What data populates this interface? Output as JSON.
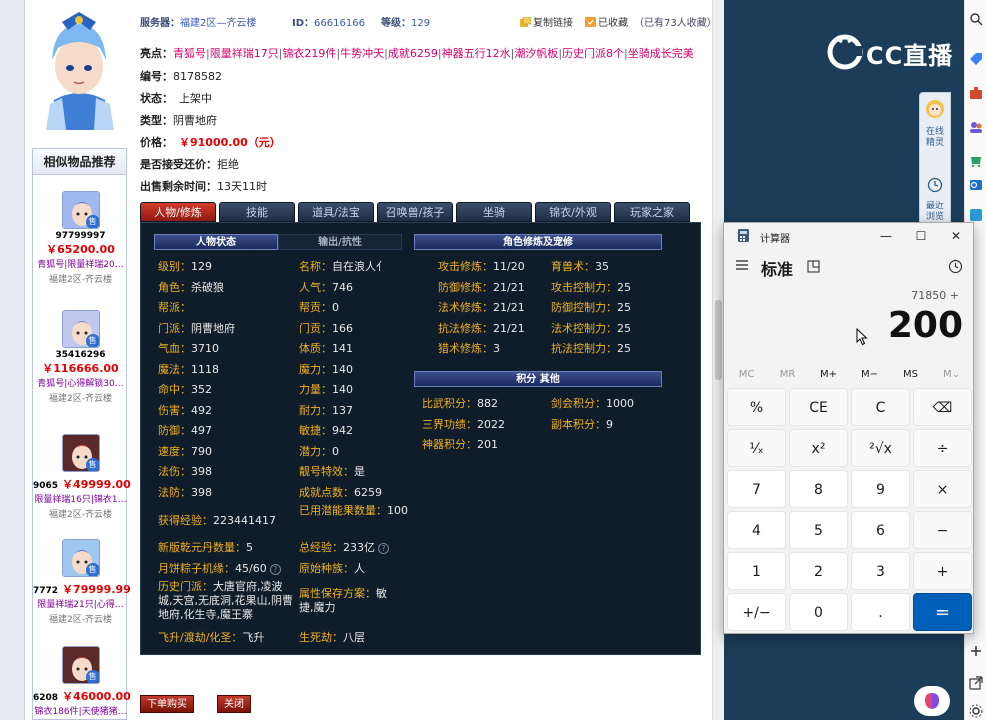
{
  "info": {
    "server_label": "服务器：",
    "server": "福建2区—齐云楼",
    "id_label": "ID：",
    "id": "66616166",
    "level_label": "等级：",
    "level": "129",
    "copy_link": "复制链接",
    "favorite": "已收藏",
    "favorite_count": "（已有73人收藏）"
  },
  "highlights": {
    "label": "亮点：",
    "items": [
      "青狐号",
      "限量祥瑞17只",
      "锦衣219件",
      "牛势冲天",
      "成就6259",
      "神器五行12水",
      "潮汐帆板",
      "历史门派8个",
      "坐骑成长完美"
    ]
  },
  "props": {
    "serial_label": "编号：",
    "serial": "8178582",
    "status_label": "状态：",
    "status": "上架中",
    "type_label": "类型：",
    "type": "阴曹地府",
    "price_label": "价格：",
    "price": "￥91000.00（元）",
    "bargain_label": "是否接受还价：",
    "bargain": "拒绝",
    "remain_label": "出售剩余时间：",
    "remain": "13天11时"
  },
  "sidebar": {
    "title": "相似物品推荐",
    "tag": "售",
    "items": [
      {
        "id": "97799997",
        "price": "￥65200.00",
        "highlights": "青狐号|限量祥瑞20…",
        "server": "福建2区-齐云楼"
      },
      {
        "id": "35416296",
        "price": "￥116666.00",
        "highlights": "青狐号|心得解锁30…",
        "server": "福建2区-齐云楼"
      },
      {
        "id": "9065",
        "price": "￥49999.00",
        "highlights": "限量祥瑞16只|锦衣1…",
        "server": "福建2区-齐云楼"
      },
      {
        "id": "7772",
        "price": "￥79999.99",
        "highlights": "限量祥瑞21只|心得…",
        "server": "福建2区-齐云楼"
      },
      {
        "id": "6208",
        "price": "￥46000.00",
        "highlights": "锦衣186件|天使猪猪…",
        "server": ""
      }
    ]
  },
  "tabs": [
    "人物/修炼",
    "技能",
    "道具/法宝",
    "召唤兽/孩子",
    "坐骑",
    "锦衣/外观",
    "玩家之家"
  ],
  "panel": {
    "hdr_status": "人物状态",
    "hdr_output": "输出/抗性",
    "hdr_cultivation": "角色修炼及宠修",
    "hdr_points": "积分 其他",
    "left_col": [
      {
        "k": "级别：",
        "v": "129"
      },
      {
        "k": "角色：",
        "v": "杀破狼"
      },
      {
        "k": "帮派：",
        "v": ""
      },
      {
        "k": "门派：",
        "v": "阴曹地府"
      },
      {
        "k": "气血：",
        "v": "3710"
      },
      {
        "k": "魔法：",
        "v": "1118"
      },
      {
        "k": "命中：",
        "v": "352"
      },
      {
        "k": "伤害：",
        "v": "492"
      },
      {
        "k": "防御：",
        "v": "497"
      },
      {
        "k": "速度：",
        "v": "790"
      },
      {
        "k": "法伤：",
        "v": "398"
      },
      {
        "k": "法防：",
        "v": "398"
      }
    ],
    "mid_col": [
      {
        "k": "名称：",
        "v": "自在浪人亻"
      },
      {
        "k": "人气：",
        "v": "746"
      },
      {
        "k": "帮贡：",
        "v": "0"
      },
      {
        "k": "门贡：",
        "v": "166"
      },
      {
        "k": "体质：",
        "v": "141"
      },
      {
        "k": "魔力：",
        "v": "140"
      },
      {
        "k": "力量：",
        "v": "140"
      },
      {
        "k": "耐力：",
        "v": "137"
      },
      {
        "k": "敏捷：",
        "v": "942"
      },
      {
        "k": "潜力：",
        "v": "0"
      },
      {
        "k": "靓号特效：",
        "v": "是"
      },
      {
        "k": "成就点数：",
        "v": "6259"
      }
    ],
    "exp_k": "获得经验：",
    "exp_v": "223441417",
    "used_k": "已用潜能果数量：",
    "used_v": "100",
    "qianyuan_k": "新版乾元丹数量：",
    "qianyuan_v": "5",
    "total_exp_k": "总经验：",
    "total_exp_v": "233亿",
    "zongzi_k": "月饼粽子机缘：",
    "zongzi_v": "45/60",
    "race_k": "原始种族：",
    "race_v": "人",
    "history_k": "历史门派：",
    "history_v": "大唐官府,凌波城,天宫,无底洞,花果山,阴曹地府,化生寺,魔王寨",
    "scheme_k": "属性保存方案：",
    "scheme_v": "敏捷,魔力",
    "ascend_k": "飞升/渡劫/化圣：",
    "ascend_v": "飞升",
    "life_k": "生死劫：",
    "life_v": "八层",
    "cult_left": [
      {
        "k": "攻击修炼：",
        "v": "11/20"
      },
      {
        "k": "防御修炼：",
        "v": "21/21"
      },
      {
        "k": "法术修炼：",
        "v": "21/21"
      },
      {
        "k": "抗法修炼：",
        "v": "21/21"
      },
      {
        "k": "猎术修炼：",
        "v": "3"
      }
    ],
    "cult_right": [
      {
        "k": "育兽术：",
        "v": "35"
      },
      {
        "k": "攻击控制力：",
        "v": "25"
      },
      {
        "k": "防御控制力：",
        "v": "25"
      },
      {
        "k": "法术控制力：",
        "v": "25"
      },
      {
        "k": "抗法控制力：",
        "v": "25"
      }
    ],
    "points_left": [
      {
        "k": "比武积分：",
        "v": "882"
      },
      {
        "k": "三界功绩：",
        "v": "2022"
      },
      {
        "k": "神器积分：",
        "v": "201"
      }
    ],
    "points_right": [
      {
        "k": "剑会积分：",
        "v": "1000"
      },
      {
        "k": "副本积分：",
        "v": "9"
      }
    ],
    "qmark": "?"
  },
  "buttons": {
    "buy": "下单购买",
    "close": "关闭"
  },
  "stream": {
    "logo": "CC直播",
    "float1": "在线精灵",
    "float2": "最近浏览"
  },
  "calculator": {
    "title": "计算器",
    "mode": "标准",
    "expression": "71850 +",
    "display": "200",
    "win_min": "—",
    "win_max": "☐",
    "win_close": "✕",
    "memory": [
      "MC",
      "MR",
      "M+",
      "M−",
      "MS",
      "M⌄"
    ],
    "keys": [
      "%",
      "CE",
      "C",
      "⌫",
      "¹⁄ₓ",
      "x²",
      "²√x",
      "÷",
      "7",
      "8",
      "9",
      "×",
      "4",
      "5",
      "6",
      "−",
      "1",
      "2",
      "3",
      "+",
      "+/−",
      "0",
      ".",
      "="
    ]
  }
}
